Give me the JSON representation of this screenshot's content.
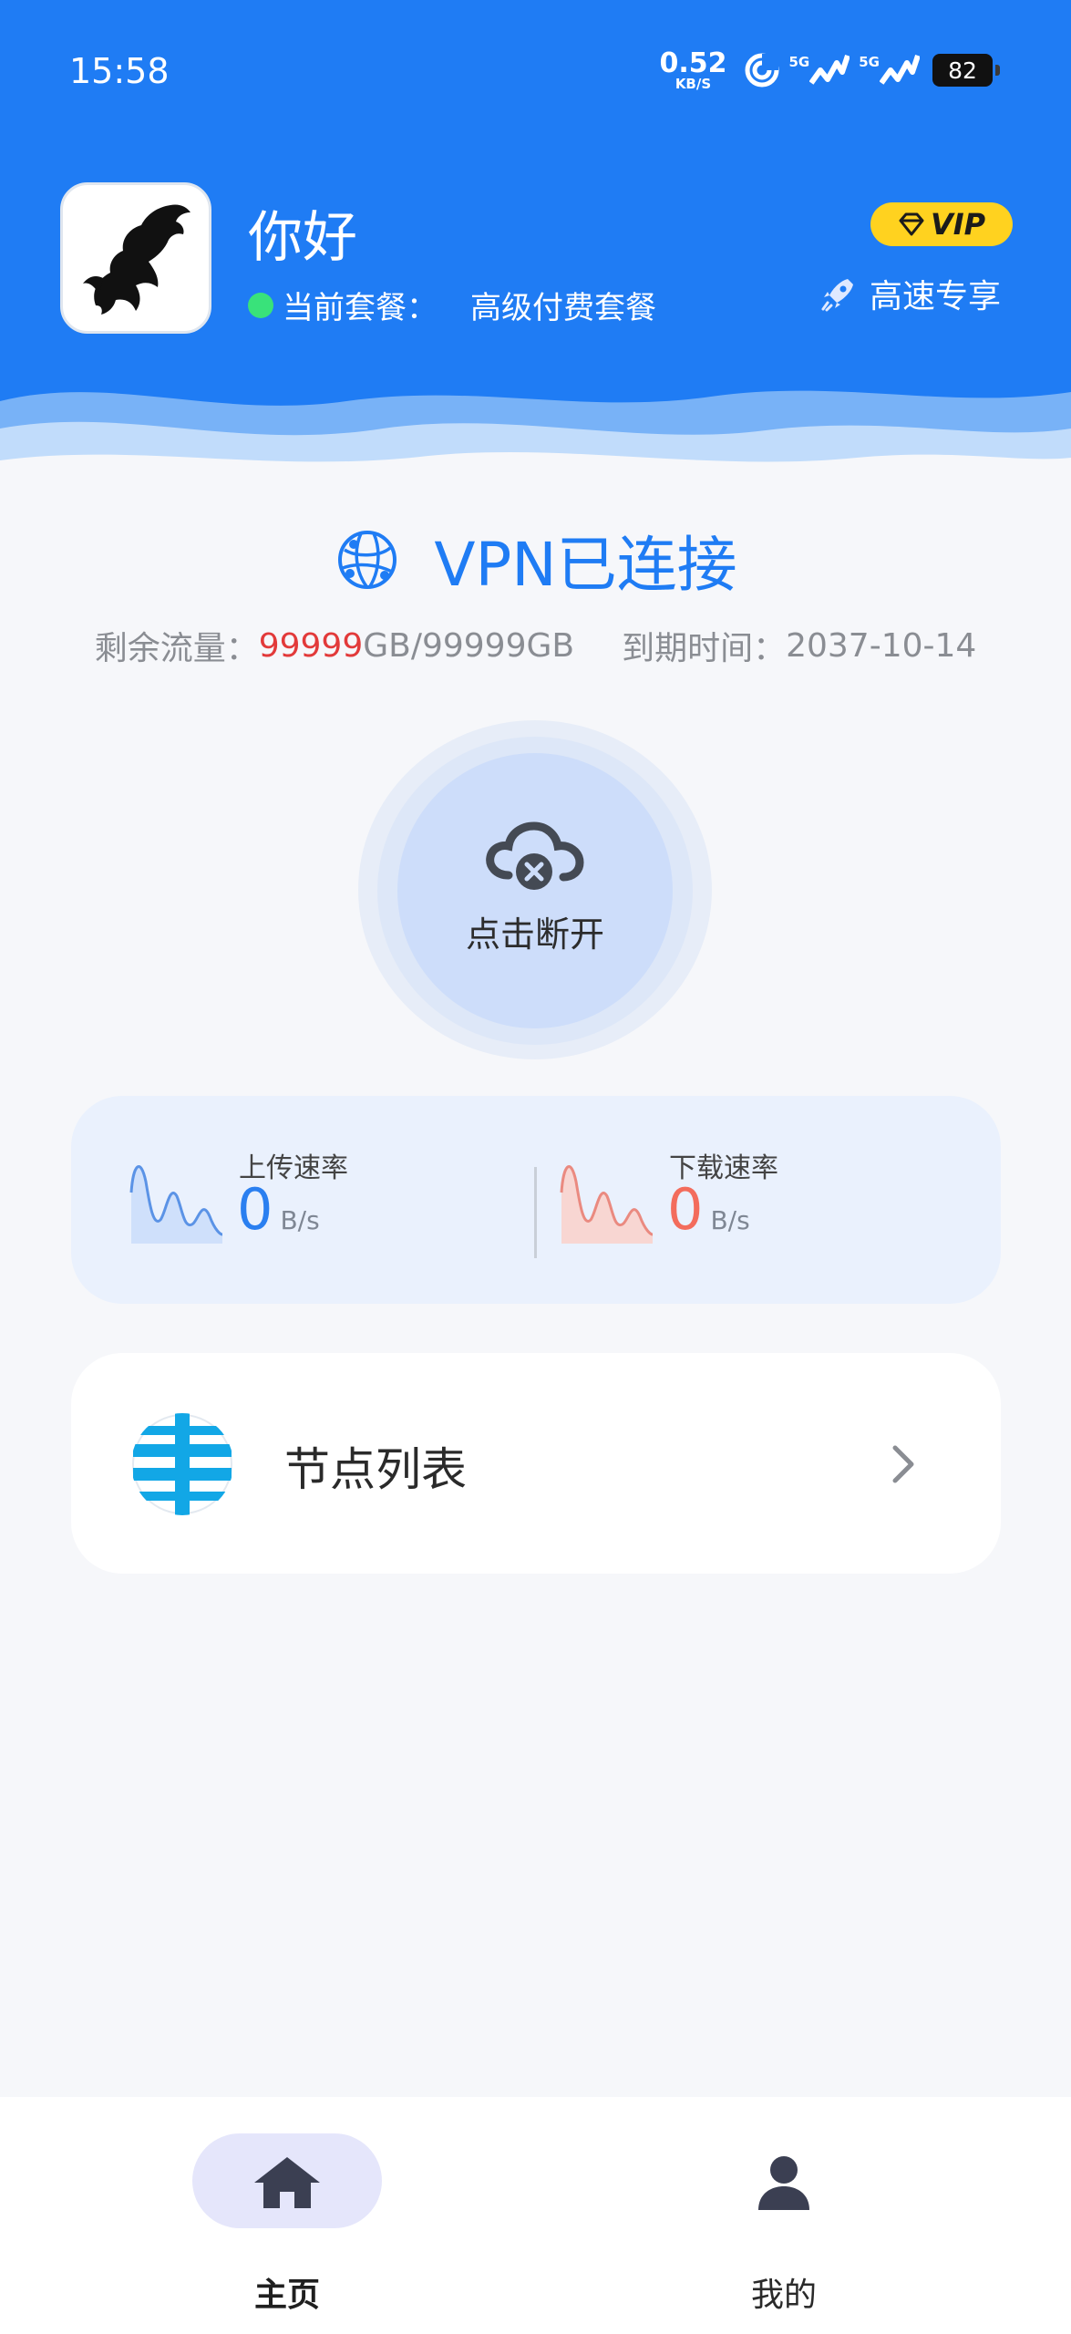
{
  "status_bar": {
    "time": "15:58",
    "net_speed_value": "0.52",
    "net_speed_unit": "KB/S",
    "signal_1": "5G",
    "signal_2": "5G",
    "battery": "82"
  },
  "header": {
    "greeting": "你好",
    "plan_label": "当前套餐：",
    "plan_value": "高级付费套餐",
    "vip_badge": "VIP",
    "speed_label": "高速专享"
  },
  "connection": {
    "status": "VPN已连接",
    "traffic_label": "剩余流量：",
    "traffic_used": "99999",
    "traffic_rest": "GB/99999GB",
    "expire_label": "到期时间：",
    "expire_date": "2037-10-14",
    "button_label": "点击断开"
  },
  "speed": {
    "upload_title": "上传速率",
    "upload_value": "0",
    "upload_unit": "B/s",
    "download_title": "下载速率",
    "download_value": "0",
    "download_unit": "B/s"
  },
  "node_list": {
    "label": "节点列表"
  },
  "tabbar": {
    "home": "主页",
    "mine": "我的"
  },
  "colors": {
    "header_blue": "#1f7cf4",
    "upload_blue": "#2a7ff0",
    "download_red": "#f36c5c",
    "vip_yellow": "#ffd21f",
    "online_green": "#39e27a"
  },
  "icons": [
    "wifi-icon",
    "signal-icon",
    "battery-icon",
    "horse-logo",
    "vip-diamond-icon",
    "rocket-icon",
    "network-globe-icon",
    "cloud-disconnect-icon",
    "upload-wave-icon",
    "download-wave-icon",
    "node-list-icon",
    "chevron-right-icon",
    "home-icon",
    "user-icon"
  ]
}
